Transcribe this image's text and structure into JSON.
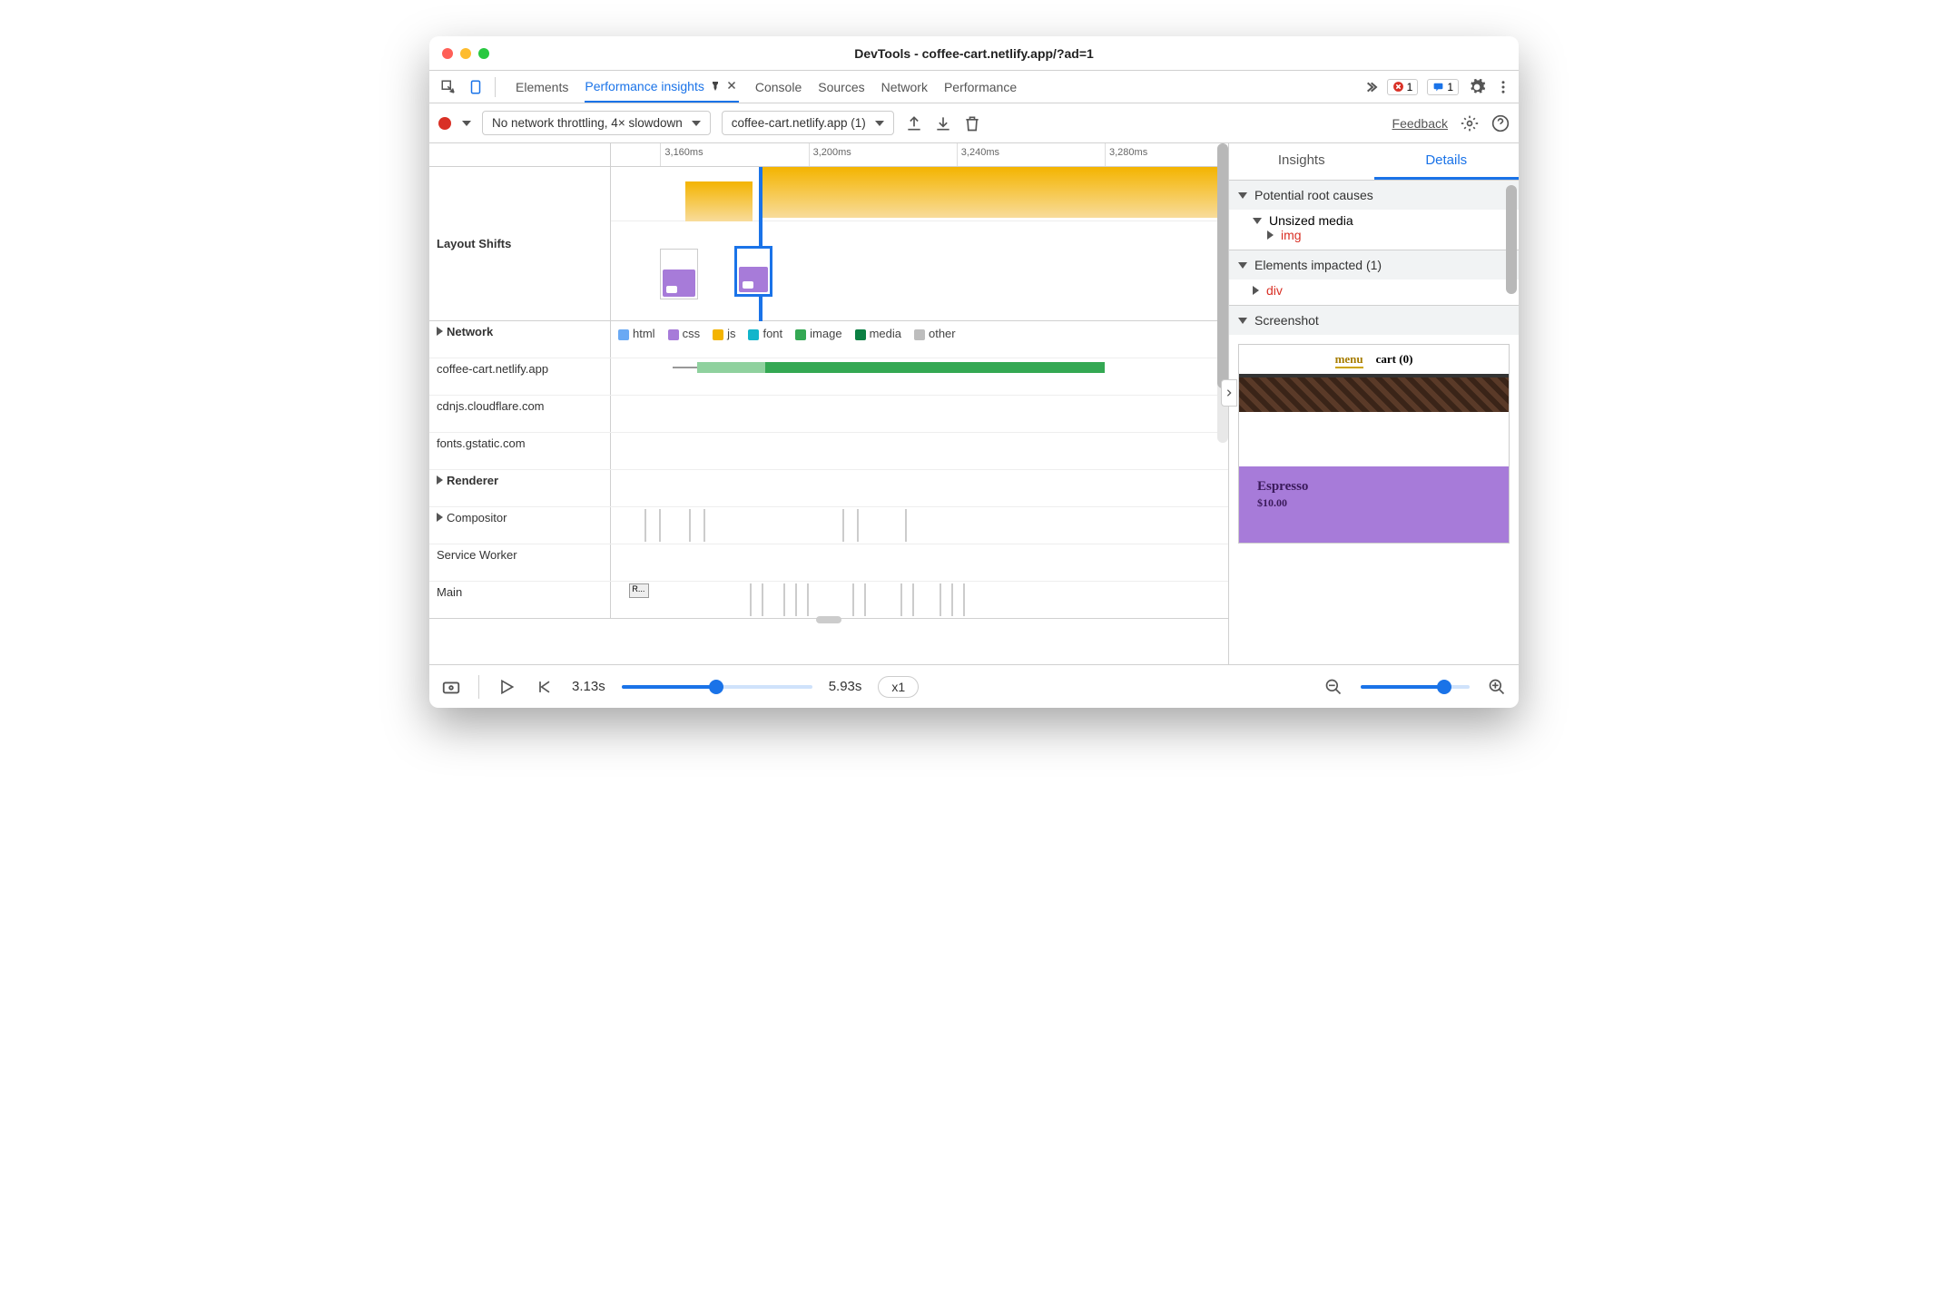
{
  "title": "DevTools - coffee-cart.netlify.app/?ad=1",
  "tabs": [
    "Elements",
    "Performance insights",
    "Console",
    "Sources",
    "Network",
    "Performance"
  ],
  "activeTab": "Performance insights",
  "errCount": "1",
  "msgCount": "1",
  "toolbar": {
    "throttling": "No network throttling, 4× slowdown",
    "target": "coffee-cart.netlify.app (1)",
    "feedback": "Feedback"
  },
  "timeline": {
    "ticks": [
      "3,160ms",
      "3,200ms",
      "3,240ms",
      "3,280ms"
    ],
    "layoutShiftsLabel": "Layout Shifts"
  },
  "network": {
    "label": "Network",
    "legend": [
      {
        "label": "html",
        "color": "#6aa9f4"
      },
      {
        "label": "css",
        "color": "#a77bd9"
      },
      {
        "label": "js",
        "color": "#f4b400"
      },
      {
        "label": "font",
        "color": "#12b5cb"
      },
      {
        "label": "image",
        "color": "#34a853"
      },
      {
        "label": "media",
        "color": "#0b8043"
      },
      {
        "label": "other",
        "color": "#bdbdbd"
      }
    ],
    "hosts": [
      "coffee-cart.netlify.app",
      "cdnjs.cloudflare.com",
      "fonts.gstatic.com"
    ]
  },
  "renderer": {
    "label": "Renderer",
    "rows": [
      "Compositor",
      "Service Worker",
      "Main"
    ],
    "mainBlock": "R..."
  },
  "rightPanel": {
    "tabs": [
      "Insights",
      "Details"
    ],
    "active": "Details",
    "sections": {
      "rootCauses": "Potential root causes",
      "unsized": "Unsized media",
      "imgEl": "img",
      "impacted": "Elements impacted (1)",
      "divEl": "div",
      "screenshot": "Screenshot"
    },
    "preview": {
      "menu": "menu",
      "cart": "cart (0)",
      "item": "Espresso",
      "price": "$10.00"
    }
  },
  "footer": {
    "start": "3.13s",
    "end": "5.93s",
    "speed": "x1"
  }
}
